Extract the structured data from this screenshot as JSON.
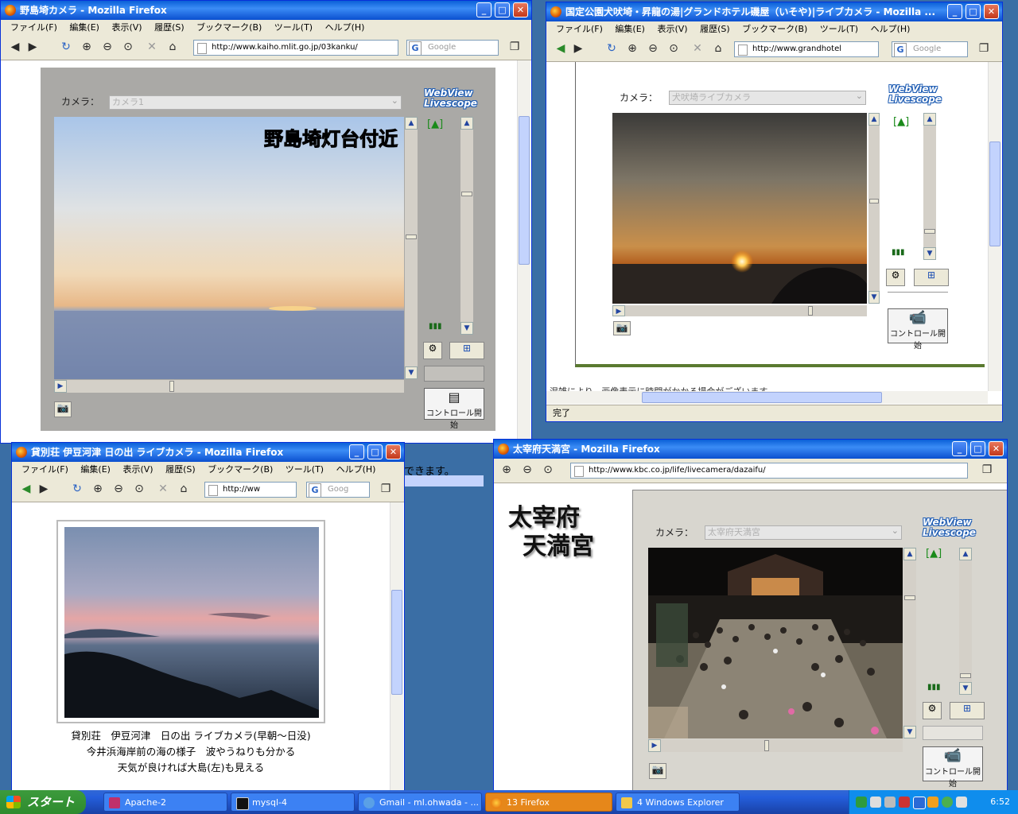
{
  "window1": {
    "title": "野島埼カメラ - Mozilla Firefox",
    "url": "http://www.kaiho.mlit.go.jp/03kanku/",
    "search_placeholder": "Google",
    "menu": [
      "ファイル(F)",
      "編集(E)",
      "表示(V)",
      "履歴(S)",
      "ブックマーク(B)",
      "ツール(T)",
      "ヘルプ(H)"
    ],
    "camera_label": "カメラ：",
    "camera_option": "カメラ1",
    "overlay_text": "野島埼灯台付近",
    "logo_line1": "WebView",
    "logo_line2": "Livescope",
    "control_button": "コントロール開始",
    "below_text": "できます。"
  },
  "window2": {
    "title": "国定公園犬吠埼・昇龍の湯|グランドホテル磯屋（いそや)|ライブカメラ - Mozilla ...",
    "url": "http://www.grandhotel",
    "search_placeholder": "Google",
    "menu": [
      "ファイル(F)",
      "編集(E)",
      "表示(V)",
      "履歴(S)",
      "ブックマーク(B)",
      "ツール(T)",
      "ヘルプ(H)"
    ],
    "camera_label": "カメラ：",
    "camera_option": "犬吠埼ライブカメラ",
    "logo_line1": "WebView",
    "logo_line2": "Livescope",
    "control_button": "コントロール開始",
    "status": "完了",
    "cut_text": "混雑により、画像表示に時間がかかる場合がございます。"
  },
  "window3": {
    "title": "貸別荘 伊豆河津 日の出 ライブカメラ - Mozilla Firefox",
    "url": "http://ww",
    "search_placeholder": "Goog",
    "menu": [
      "ファイル(F)",
      "編集(E)",
      "表示(V)",
      "履歴(S)",
      "ブックマーク(B)",
      "ツール(T)",
      "ヘルプ(H)"
    ],
    "caption_lines": [
      "貸別荘　伊豆河津　日の出 ライブカメラ(早朝～日没)",
      "今井浜海岸前の海の様子　波やうねりも分かる",
      "天気が良ければ大島(左)も見える"
    ]
  },
  "window4": {
    "title": "太宰府天満宮 - Mozilla Firefox",
    "url": "http://www.kbc.co.jp/life/livecamera/dazaifu/",
    "heading_line1": "太宰府",
    "heading_line2": "天満宮",
    "camera_label": "カメラ：",
    "camera_option": "太宰府天満宮",
    "logo_line1": "WebView",
    "logo_line2": "Livescope",
    "control_button": "コントロール開始"
  },
  "taskbar": {
    "start_label": "スタート",
    "tasks": [
      "Apache-2",
      "mysql-4",
      "Gmail - ml.ohwada - ...",
      "13 Firefox",
      "4 Windows Explorer"
    ],
    "clock": "6:52"
  }
}
